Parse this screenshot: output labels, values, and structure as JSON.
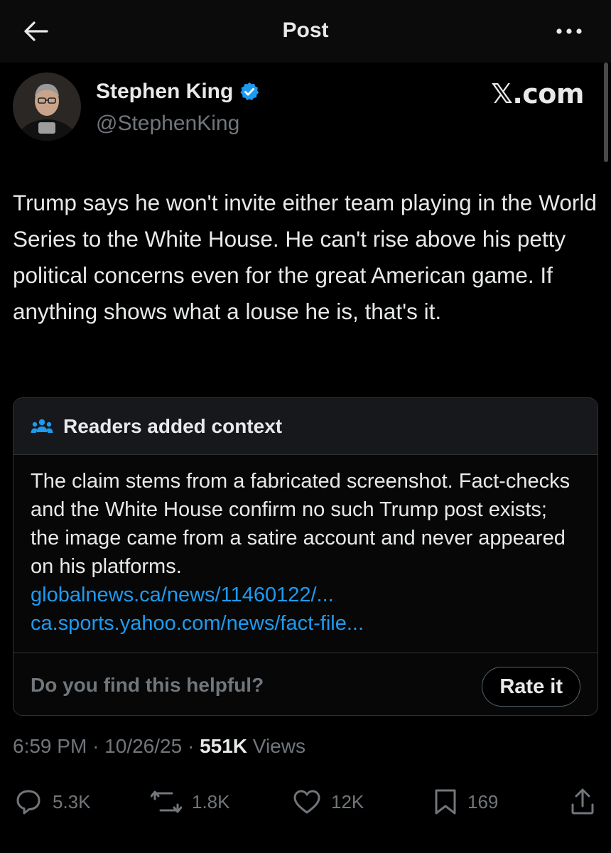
{
  "header": {
    "title": "Post",
    "back_icon": "arrow-left-icon",
    "more_icon": "more-horizontal-icon"
  },
  "author": {
    "name": "Stephen King",
    "handle": "@StephenKing",
    "verified_icon": "verified-badge-icon",
    "verified_color": "#1d9bf0"
  },
  "source_mark": "𝕏.com",
  "post": {
    "text": "Trump says he won't invite either team playing in the World Series to the White House. He can't rise above his petty political concerns even for the great American game. If anything shows what a louse he is, that's it."
  },
  "community_note": {
    "icon": "people-icon",
    "title": "Readers added context",
    "body": "The claim stems from a fabricated screenshot. Fact-checks and the White House confirm no such Trump post exists; the image came from a satire account and never appeared on his platforms.",
    "links": [
      "globalnews.ca/news/11460122/...",
      "ca.sports.yahoo.com/news/fact-file..."
    ],
    "helpful_question": "Do you find this helpful?",
    "rate_button": "Rate it"
  },
  "meta": {
    "time": "6:59 PM",
    "date": "10/26/25",
    "separator": "·",
    "views_count": "551K",
    "views_label": "Views"
  },
  "actions": {
    "replies": "5.3K",
    "reposts": "1.8K",
    "likes": "12K",
    "bookmarks": "169"
  },
  "colors": {
    "background": "#000000",
    "text_primary": "#e7e9ea",
    "text_secondary": "#71767b",
    "link": "#1d9bf0",
    "border": "#2f3336"
  }
}
